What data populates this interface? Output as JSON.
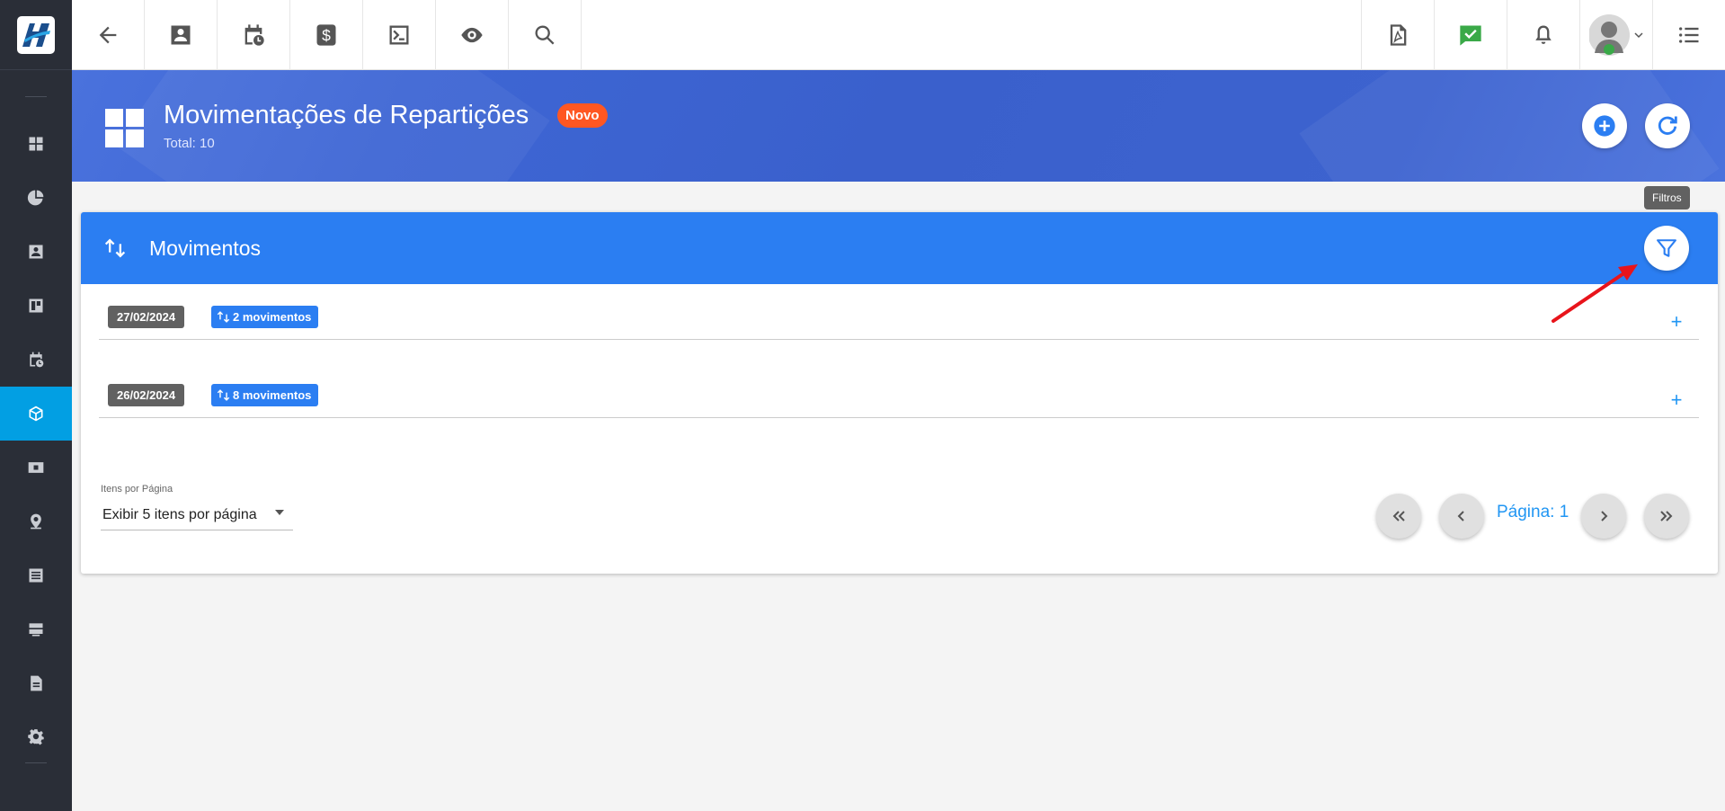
{
  "app": {
    "brand_colors": {
      "sidebar": "#2a2e37",
      "active": "#029fe3",
      "banner": "#3e66d4",
      "card_header": "#2b7ef2",
      "badge": "#ff5722"
    }
  },
  "sidebar": {
    "items": [
      {
        "icon": "dashboard-icon"
      },
      {
        "icon": "pie-chart-icon"
      },
      {
        "icon": "contact-card-icon"
      },
      {
        "icon": "board-icon"
      },
      {
        "icon": "calendar-clock-icon"
      },
      {
        "icon": "package-icon",
        "active": true
      },
      {
        "icon": "money-icon"
      },
      {
        "icon": "location-icon"
      },
      {
        "icon": "list-icon"
      },
      {
        "icon": "server-icon"
      },
      {
        "icon": "document-icon"
      },
      {
        "icon": "settings-icon"
      }
    ]
  },
  "topbar": {
    "left_buttons": [
      "back-arrow-icon",
      "contact-icon",
      "calendar-clock-icon",
      "dollar-icon",
      "terminal-icon",
      "eye-icon",
      "search-icon"
    ],
    "right_buttons": [
      "pdf-icon",
      "check-message-icon",
      "bell-icon",
      "avatar",
      "menu-list-icon"
    ]
  },
  "header": {
    "title": "Movimentações de Repartições",
    "badge": "Novo",
    "total": "Total: 10"
  },
  "tooltip": {
    "filter": "Filtros"
  },
  "card": {
    "title": "Movimentos",
    "groups": [
      {
        "date": "27/02/2024",
        "count_label": "2 movimentos"
      },
      {
        "date": "26/02/2024",
        "count_label": "8 movimentos"
      }
    ]
  },
  "pagination": {
    "per_page_label": "Itens por Página",
    "per_page_value": "Exibir 5 itens por página",
    "page_label": "Página: 1"
  }
}
